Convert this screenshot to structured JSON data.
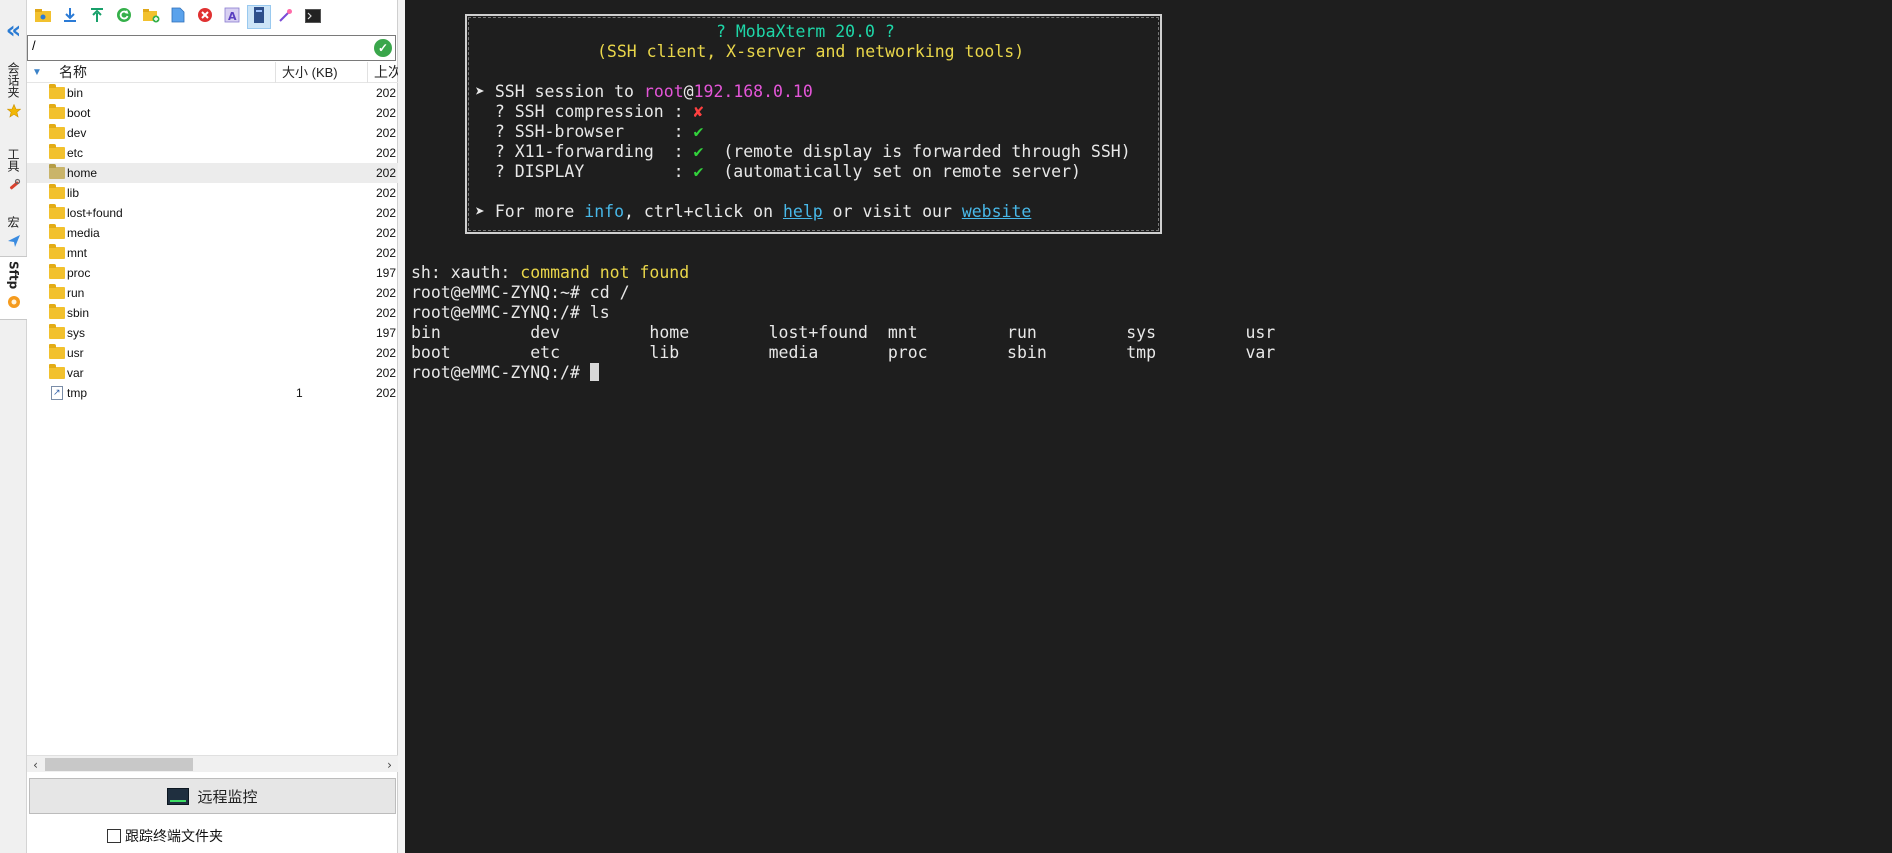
{
  "tabstrip": {
    "collapse_glyph": "«",
    "tabs": [
      {
        "label": "会话夹",
        "icon": "star-icon"
      },
      {
        "label": "工具",
        "icon": "tools-icon"
      },
      {
        "label": "宏",
        "icon": "macro-icon"
      },
      {
        "label": "Sftp",
        "icon": "sftp-icon",
        "active": true
      }
    ]
  },
  "sftp": {
    "path": "/",
    "columns": {
      "name": "名称",
      "size": "大小 (KB)",
      "date": "上次"
    },
    "files": [
      {
        "name": "bin",
        "type": "folder",
        "size": "",
        "date": "202"
      },
      {
        "name": "boot",
        "type": "folder",
        "size": "",
        "date": "202"
      },
      {
        "name": "dev",
        "type": "folder",
        "size": "",
        "date": "202"
      },
      {
        "name": "etc",
        "type": "folder",
        "size": "",
        "date": "202"
      },
      {
        "name": "home",
        "type": "folder",
        "size": "",
        "date": "202",
        "selected": true
      },
      {
        "name": "lib",
        "type": "folder",
        "size": "",
        "date": "202"
      },
      {
        "name": "lost+found",
        "type": "folder",
        "size": "",
        "date": "202"
      },
      {
        "name": "media",
        "type": "folder",
        "size": "",
        "date": "202"
      },
      {
        "name": "mnt",
        "type": "folder",
        "size": "",
        "date": "202"
      },
      {
        "name": "proc",
        "type": "folder",
        "size": "",
        "date": "197"
      },
      {
        "name": "run",
        "type": "folder",
        "size": "",
        "date": "202"
      },
      {
        "name": "sbin",
        "type": "folder",
        "size": "",
        "date": "202"
      },
      {
        "name": "sys",
        "type": "folder",
        "size": "",
        "date": "197"
      },
      {
        "name": "usr",
        "type": "folder",
        "size": "",
        "date": "202"
      },
      {
        "name": "var",
        "type": "folder",
        "size": "",
        "date": "202"
      },
      {
        "name": "tmp",
        "type": "link",
        "size": "1",
        "date": "202"
      }
    ],
    "monitor_button": "远程监控",
    "follow_checkbox": "跟踪终端文件夹"
  },
  "terminal": {
    "banner_title": "? MobaXterm 20.0 ?",
    "banner_subtitle": "(SSH client, X-server and networking tools)",
    "session_prefix": "➤ SSH session to ",
    "session_user": "root",
    "session_at": "@",
    "session_host": "192.168.0.10",
    "rows": [
      {
        "label": "  ? SSH compression : ",
        "mark": "✘",
        "mark_color": "red",
        "note": ""
      },
      {
        "label": "  ? SSH-browser     : ",
        "mark": "✔",
        "mark_color": "green",
        "note": ""
      },
      {
        "label": "  ? X11-forwarding  : ",
        "mark": "✔",
        "mark_color": "green",
        "note": "  (remote display is forwarded through SSH)"
      },
      {
        "label": "  ? DISPLAY         : ",
        "mark": "✔",
        "mark_color": "green",
        "note": "  (automatically set on remote server)"
      }
    ],
    "more_prefix": "➤ For more ",
    "more_info": "info",
    "more_mid": ", ctrl+click on ",
    "more_help": "help",
    "more_or": " or visit our ",
    "more_website": "website",
    "xauth_prefix": "sh: xauth: ",
    "xauth_msg": "command not found",
    "line_cd": "root@eMMC-ZYNQ:~# cd /",
    "line_ls": "root@eMMC-ZYNQ:/# ls",
    "ls_row1": "bin         dev         home        lost+found  mnt         run         sys         usr",
    "ls_row2": "boot        etc         lib         media       proc        sbin        tmp         var",
    "prompt": "root@eMMC-ZYNQ:/# "
  },
  "colors": {
    "terminal_bg": "#1e1e1e",
    "teal": "#1ed6a8",
    "yellow": "#e9d64a",
    "magenta": "#e455d8",
    "link": "#48b8e8"
  }
}
